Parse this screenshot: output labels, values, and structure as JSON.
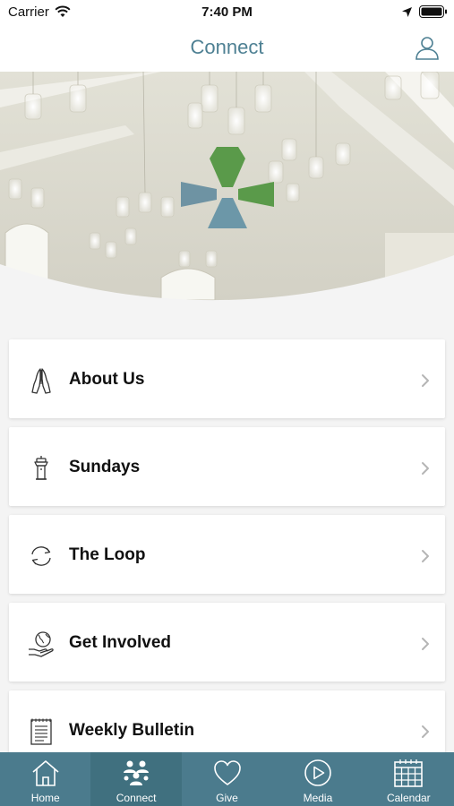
{
  "status_bar": {
    "carrier": "Carrier",
    "time": "7:40 PM"
  },
  "header": {
    "title": "Connect"
  },
  "menu": {
    "items": [
      {
        "label": "About Us",
        "icon": "praying-hands-icon"
      },
      {
        "label": "Sundays",
        "icon": "pulpit-icon"
      },
      {
        "label": "The Loop",
        "icon": "loop-arrows-icon"
      },
      {
        "label": "Get Involved",
        "icon": "globe-hand-icon"
      },
      {
        "label": "Weekly Bulletin",
        "icon": "bulletin-icon"
      }
    ]
  },
  "tabs": [
    {
      "label": "Home",
      "icon": "home-icon",
      "active": false
    },
    {
      "label": "Connect",
      "icon": "people-icon",
      "active": true
    },
    {
      "label": "Give",
      "icon": "heart-icon",
      "active": false
    },
    {
      "label": "Media",
      "icon": "play-icon",
      "active": false
    },
    {
      "label": "Calendar",
      "icon": "calendar-icon",
      "active": false
    }
  ],
  "colors": {
    "accent": "#4e8093",
    "tab_bar": "#4b7b8d",
    "logo_green": "#5a9a4a",
    "logo_blue": "#5c8799"
  }
}
